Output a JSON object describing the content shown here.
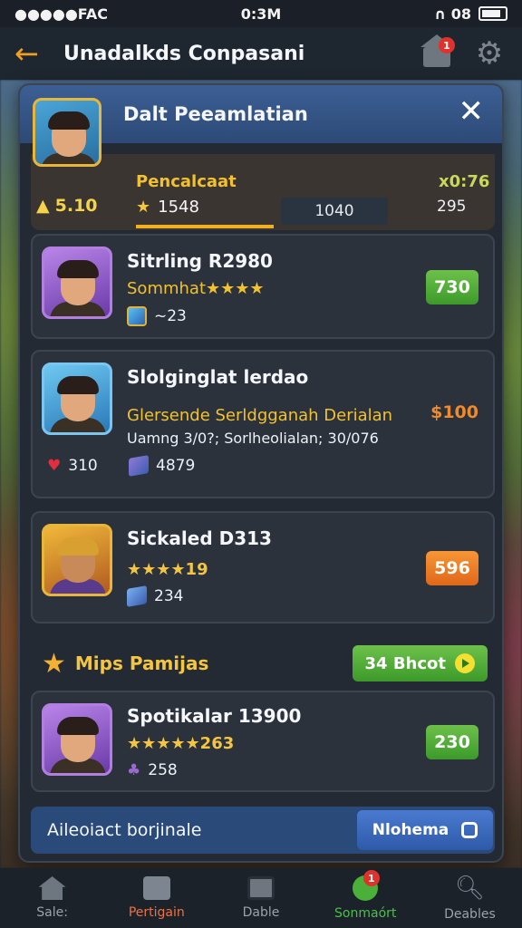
{
  "status_bar": {
    "left": "●●●●●FAC",
    "time": "0:3M",
    "right": "∩ 08"
  },
  "header": {
    "title": "Unadalkds Conpasani",
    "back_icon": "back-arrow-icon",
    "home_badge": "1",
    "gear_icon": "gear-icon"
  },
  "panel": {
    "title": "Dalt Peeamlatian",
    "close_label": "✕",
    "profile": {
      "gold": "5.10",
      "label": "Pencalcaat",
      "stars_value": "1548",
      "mid_value": "1040",
      "time": "x0:76",
      "right_value": "295"
    },
    "cards": [
      {
        "title": "Sitrling R2980",
        "subtitle": "Sommhat★★★★",
        "meta": "~23",
        "price": "730",
        "price_color": "#4caf3a"
      },
      {
        "title": "Slolginglat lerdao",
        "subtitle": "Glersende Serldgganah Derialan",
        "desc": "Uamng 3/0?; Sorlheolialan; 30/076",
        "price": "$100",
        "hearts": "310",
        "gems": "4879",
        "price_color": "#f08a2a"
      },
      {
        "title": "Sickaled D313",
        "stars": "★★★★19",
        "meta": "234",
        "price": "596",
        "price_color": "#f07a22"
      }
    ],
    "section": {
      "title": "Mips Pamijas",
      "button_label": "34 Bhcot"
    },
    "featured": {
      "title": "Spotikalar 13900",
      "stars": "★★★★★263",
      "meta": "258",
      "price": "230"
    },
    "footer": {
      "text": "Aileoiact borjinale",
      "button_label": "Nlohema"
    }
  },
  "tabs": [
    {
      "label": "Sale:",
      "icon": "home-icon"
    },
    {
      "label": "Pertigain",
      "icon": "box-icon",
      "active": true
    },
    {
      "label": "Dable",
      "icon": "tile-icon"
    },
    {
      "label": "Sonmaórt",
      "icon": "swirl-icon",
      "badge": "1"
    },
    {
      "label": "Deables",
      "icon": "search-icon"
    }
  ]
}
